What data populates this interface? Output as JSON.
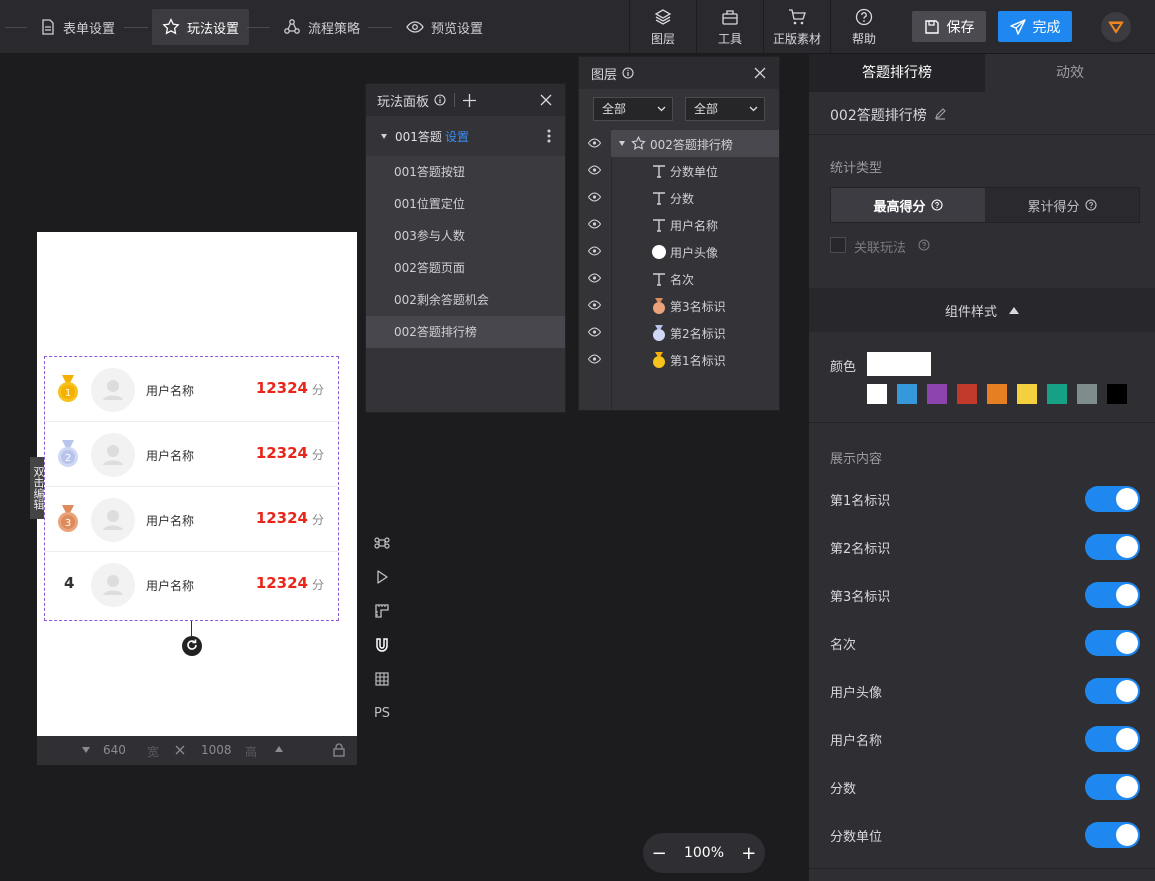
{
  "steps": [
    "表单设置",
    "玩法设置",
    "流程策略",
    "预览设置"
  ],
  "tools": [
    "图层",
    "工具",
    "正版素材",
    "帮助"
  ],
  "actions": {
    "save": "保存",
    "done": "完成"
  },
  "canvas": {
    "side_tag": "双击编辑",
    "width_value": "640",
    "width_unit": "宽",
    "height_value": "1008",
    "height_unit": "高",
    "rows": [
      {
        "rank": "1",
        "name": "用户名称",
        "score": "12324",
        "unit": "分"
      },
      {
        "rank": "2",
        "name": "用户名称",
        "score": "12324",
        "unit": "分"
      },
      {
        "rank": "3",
        "name": "用户名称",
        "score": "12324",
        "unit": "分"
      },
      {
        "rank": "4",
        "name": "用户名称",
        "score": "12324",
        "unit": "分"
      }
    ],
    "vtools_ps": "PS"
  },
  "play_panel": {
    "title": "玩法面板",
    "group": "001答题",
    "group_link": "设置",
    "items": [
      "001答题按钮",
      "001位置定位",
      "003参与人数",
      "002答题页面",
      "002剩余答题机会",
      "002答题排行榜"
    ]
  },
  "layer_panel": {
    "title": "图层",
    "filter1": "全部",
    "filter2": "全部",
    "root": "002答题排行榜",
    "children": [
      {
        "icon": "text",
        "label": "分数单位"
      },
      {
        "icon": "text",
        "label": "分数"
      },
      {
        "icon": "text",
        "label": "用户名称"
      },
      {
        "icon": "image",
        "label": "用户头像"
      },
      {
        "icon": "text",
        "label": "名次"
      },
      {
        "icon": "medal",
        "label": "第3名标识"
      },
      {
        "icon": "medal",
        "label": "第2名标识"
      },
      {
        "icon": "medal",
        "label": "第1名标识"
      }
    ]
  },
  "right_panel": {
    "tabs": [
      "答题排行榜",
      "动效"
    ],
    "component_name": "002答题排行榜",
    "stat_type_label": "统计类型",
    "stat_options": [
      "最高得分",
      "累计得分"
    ],
    "link_play": "关联玩法",
    "style_title": "组件样式",
    "color_label": "颜色",
    "swatches": [
      "#ffffff",
      "#3498db",
      "#8e44ad",
      "#c0392b",
      "#e67e22",
      "#f4d03f",
      "#16a085",
      "#7f8c8d",
      "#000000"
    ],
    "display_title": "展示内容",
    "display_items": [
      "第1名标识",
      "第2名标识",
      "第3名标识",
      "名次",
      "用户头像",
      "用户名称",
      "分数",
      "分数单位"
    ]
  },
  "zoom": {
    "value": "100%",
    "minus": "−",
    "plus": "+"
  }
}
